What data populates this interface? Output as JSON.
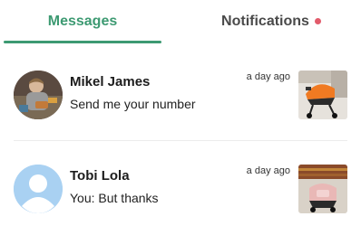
{
  "tabs": {
    "messages_label": "Messages",
    "notifications_label": "Notifications",
    "active": "messages",
    "accent_color": "#3d9a72",
    "notification_dot_color": "#e25b6b"
  },
  "conversations": [
    {
      "name": "Mikel James",
      "preview": "Send me your number",
      "time": "a day ago",
      "avatar": "user-photo",
      "thumbnail": "stroller-orange-photo"
    },
    {
      "name": "Tobi Lola",
      "preview": "You: But thanks",
      "time": "a day ago",
      "avatar": "default-user-icon",
      "thumbnail": "car-seat-pink-photo"
    }
  ]
}
